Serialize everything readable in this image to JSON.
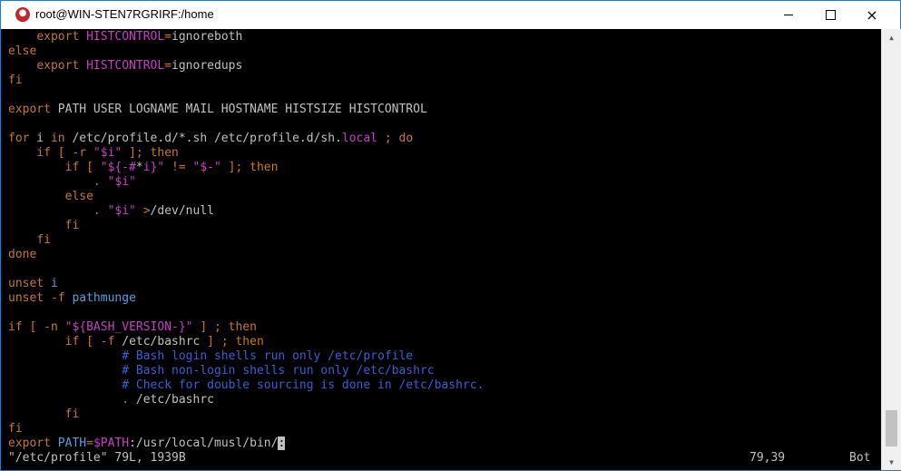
{
  "window": {
    "title": "root@WIN-STEN7RGRIRF:/home",
    "controls": {
      "minimize": "minimize",
      "maximize": "maximize",
      "close": "×"
    }
  },
  "editor": {
    "lines": [
      [
        {
          "t": "    "
        },
        {
          "c": "kw",
          "t": "export"
        },
        {
          "t": " "
        },
        {
          "c": "id",
          "t": "HISTCONTROL"
        },
        {
          "c": "kw",
          "t": "="
        },
        {
          "t": "ignoreboth"
        }
      ],
      [
        {
          "c": "kw",
          "t": "else"
        }
      ],
      [
        {
          "t": "    "
        },
        {
          "c": "kw",
          "t": "export"
        },
        {
          "t": " "
        },
        {
          "c": "id",
          "t": "HISTCONTROL"
        },
        {
          "c": "kw",
          "t": "="
        },
        {
          "t": "ignoredups"
        }
      ],
      [
        {
          "c": "kw",
          "t": "fi"
        }
      ],
      [],
      [
        {
          "c": "kw",
          "t": "export"
        },
        {
          "t": " PATH USER LOGNAME MAIL HOSTNAME HISTSIZE HISTCONTROL"
        }
      ],
      [],
      [
        {
          "c": "kw",
          "t": "for"
        },
        {
          "t": " i "
        },
        {
          "c": "kw",
          "t": "in"
        },
        {
          "t": " /etc/profile.d/*.sh /etc/profile.d/sh."
        },
        {
          "c": "id",
          "t": "local"
        },
        {
          "t": " "
        },
        {
          "c": "kw",
          "t": ";"
        },
        {
          "t": " "
        },
        {
          "c": "kw",
          "t": "do"
        }
      ],
      [
        {
          "t": "    "
        },
        {
          "c": "kw",
          "t": "if"
        },
        {
          "t": " "
        },
        {
          "c": "kw",
          "t": "[ -r"
        },
        {
          "t": " "
        },
        {
          "c": "str",
          "t": "\"$i\""
        },
        {
          "t": " "
        },
        {
          "c": "kw",
          "t": "]; then"
        }
      ],
      [
        {
          "t": "        "
        },
        {
          "c": "kw",
          "t": "if"
        },
        {
          "t": " "
        },
        {
          "c": "kw",
          "t": "["
        },
        {
          "t": " "
        },
        {
          "c": "str",
          "t": "\"${-#"
        },
        {
          "t": "*"
        },
        {
          "c": "str",
          "t": "i}\""
        },
        {
          "t": " "
        },
        {
          "c": "kw",
          "t": "!="
        },
        {
          "t": " "
        },
        {
          "c": "str",
          "t": "\"$-\""
        },
        {
          "t": " "
        },
        {
          "c": "kw",
          "t": "]; then"
        }
      ],
      [
        {
          "t": "            "
        },
        {
          "c": "kw",
          "t": "."
        },
        {
          "t": " "
        },
        {
          "c": "str",
          "t": "\"$i\""
        }
      ],
      [
        {
          "t": "        "
        },
        {
          "c": "kw",
          "t": "else"
        }
      ],
      [
        {
          "t": "            "
        },
        {
          "c": "kw",
          "t": "."
        },
        {
          "t": " "
        },
        {
          "c": "str",
          "t": "\"$i\""
        },
        {
          "t": " "
        },
        {
          "c": "kw",
          "t": ">"
        },
        {
          "t": "/dev/null"
        }
      ],
      [
        {
          "t": "        "
        },
        {
          "c": "kw",
          "t": "fi"
        }
      ],
      [
        {
          "t": "    "
        },
        {
          "c": "kw",
          "t": "fi"
        }
      ],
      [
        {
          "c": "kw",
          "t": "done"
        }
      ],
      [],
      [
        {
          "c": "kw",
          "t": "unset"
        },
        {
          "t": " "
        },
        {
          "c": "fn",
          "t": "i"
        }
      ],
      [
        {
          "c": "kw",
          "t": "unset"
        },
        {
          "t": " "
        },
        {
          "c": "kw",
          "t": "-f"
        },
        {
          "t": " "
        },
        {
          "c": "fn",
          "t": "pathmunge"
        }
      ],
      [],
      [
        {
          "c": "kw",
          "t": "if"
        },
        {
          "t": " "
        },
        {
          "c": "kw",
          "t": "[ -n"
        },
        {
          "t": " "
        },
        {
          "c": "str",
          "t": "\"${BASH_VERSION-}\""
        },
        {
          "t": " "
        },
        {
          "c": "kw",
          "t": "] ; then"
        }
      ],
      [
        {
          "t": "        "
        },
        {
          "c": "kw",
          "t": "if"
        },
        {
          "t": " "
        },
        {
          "c": "kw",
          "t": "[ -f"
        },
        {
          "t": " /etc/bashrc "
        },
        {
          "c": "kw",
          "t": "] ; then"
        }
      ],
      [
        {
          "t": "                "
        },
        {
          "c": "cm",
          "t": "# Bash login shells run only /etc/profile"
        }
      ],
      [
        {
          "t": "                "
        },
        {
          "c": "cm",
          "t": "# Bash non-login shells run only /etc/bashrc"
        }
      ],
      [
        {
          "t": "                "
        },
        {
          "c": "cm",
          "t": "# Check for double sourcing is done in /etc/bashrc."
        }
      ],
      [
        {
          "t": "                "
        },
        {
          "c": "kw",
          "t": "."
        },
        {
          "t": " /etc/bashrc"
        }
      ],
      [
        {
          "t": "        "
        },
        {
          "c": "kw",
          "t": "fi"
        }
      ],
      [
        {
          "c": "kw",
          "t": "fi"
        }
      ],
      [
        {
          "c": "kw",
          "t": "export"
        },
        {
          "t": " "
        },
        {
          "c": "fn",
          "t": "PATH"
        },
        {
          "c": "kw",
          "t": "="
        },
        {
          "c": "id",
          "t": "$PATH"
        },
        {
          "t": ":/usr/local/musl/bin/"
        },
        {
          "c": "cursor",
          "t": ":"
        }
      ]
    ],
    "status": {
      "file_info": "\"/etc/profile\" 79L, 1939B",
      "position": "79,39",
      "scroll": "Bot"
    }
  },
  "colors": {
    "keyword": "#c9772e",
    "identifier": "#c73fc7",
    "comment": "#3b5ed8",
    "text": "#c0c0c0",
    "background": "#000000",
    "window_border": "#1d7bd6"
  }
}
